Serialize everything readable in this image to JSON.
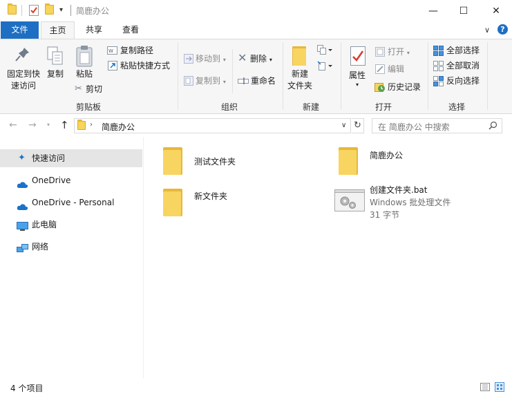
{
  "window": {
    "title": "简鹿办公",
    "controls": {
      "minimize": "—",
      "maximize": "☐",
      "close": "✕"
    }
  },
  "ribbon_tabs": [
    {
      "label": "文件"
    },
    {
      "label": "主页"
    },
    {
      "label": "共享"
    },
    {
      "label": "查看"
    }
  ],
  "ribbon": {
    "clipboard": {
      "pin_label_line1": "固定到快",
      "pin_label_line2": "速访问",
      "copy_label": "复制",
      "paste_label": "粘贴",
      "copy_path_label": "复制路径",
      "paste_shortcut_label": "粘贴快捷方式",
      "cut_label": "剪切",
      "group_label": "剪贴板"
    },
    "organize": {
      "move_to_label": "移动到",
      "copy_to_label": "复制到",
      "delete_label": "删除",
      "rename_label": "重命名",
      "group_label": "组织"
    },
    "new": {
      "new_folder_line1": "新建",
      "new_folder_line2": "文件夹",
      "group_label": "新建"
    },
    "open": {
      "properties_label": "属性",
      "open_label": "打开",
      "edit_label": "编辑",
      "history_label": "历史记录",
      "group_label": "打开"
    },
    "select": {
      "select_all_label": "全部选择",
      "select_none_label": "全部取消",
      "invert_label": "反向选择",
      "group_label": "选择"
    }
  },
  "address_bar": {
    "path_segment": "简鹿办公",
    "search_placeholder": "在 简鹿办公 中搜索"
  },
  "nav_pane": {
    "items": [
      {
        "label": "快速访问",
        "icon": "pin-icon"
      },
      {
        "label": "OneDrive",
        "icon": "cloud-icon"
      },
      {
        "label": "OneDrive - Personal",
        "icon": "cloud-icon"
      },
      {
        "label": "此电脑",
        "icon": "computer-icon"
      },
      {
        "label": "网络",
        "icon": "network-icon"
      }
    ]
  },
  "files": [
    {
      "name": "测试文件夹",
      "type": "folder"
    },
    {
      "name": "简鹿办公",
      "type": "folder"
    },
    {
      "name": "新文件夹",
      "type": "folder"
    },
    {
      "name": "创建文件夹.bat",
      "type": "batch",
      "type_label": "Windows 批处理文件",
      "size": "31 字节"
    }
  ],
  "status": {
    "item_count": "4 个项目"
  },
  "colors": {
    "file_tab": "#1e6fc3",
    "folder": "#f8d461",
    "selection": "#e5e5e5",
    "link_blue": "#1a73c8"
  }
}
